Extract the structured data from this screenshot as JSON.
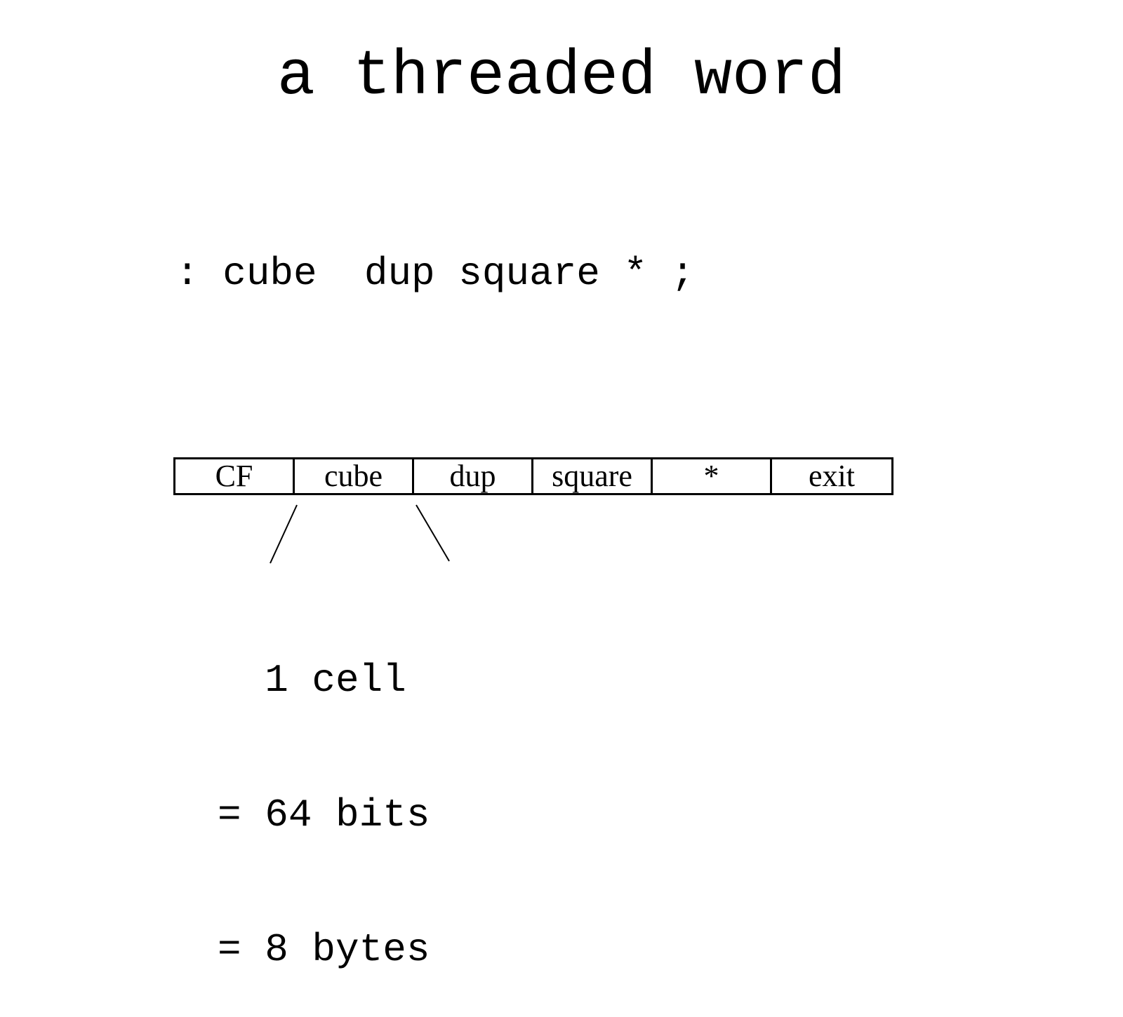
{
  "title": "a threaded word",
  "code": ": cube  dup square * ;",
  "cells": [
    "CF",
    "cube",
    "dup",
    "square",
    "*",
    "exit"
  ],
  "annotation": {
    "line1": "  1 cell",
    "line2": "= 64 bits",
    "line3": "= 8 bytes"
  }
}
